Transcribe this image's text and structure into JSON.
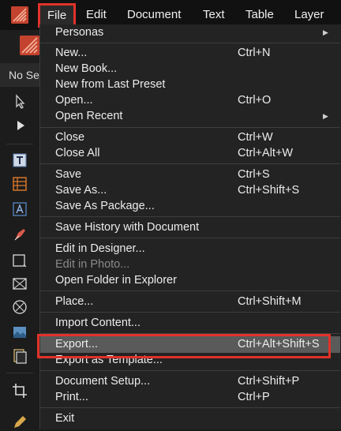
{
  "colors": {
    "accent_red": "#e0322a",
    "menu_bg": "#232323",
    "highlight": "#5a5a5a",
    "logo": "#c4432f"
  },
  "menubar": {
    "items": [
      "File",
      "Edit",
      "Document",
      "Text",
      "Table",
      "Layer"
    ],
    "active": "File"
  },
  "context": {
    "no_selection": "No Se"
  },
  "tools": [
    "pointer-icon",
    "node-icon",
    "text-frame-icon",
    "table-icon",
    "artistic-text-icon",
    "pen-icon",
    "rectangle-icon",
    "picture-frame-icon",
    "ellipse-icon",
    "image-icon",
    "place-icon",
    "crop-icon",
    "pencil-icon"
  ],
  "file_menu": {
    "personas": "Personas",
    "new": {
      "label": "New...",
      "shortcut": "Ctrl+N"
    },
    "new_book": "New Book...",
    "new_from_preset": "New from Last Preset",
    "open": {
      "label": "Open...",
      "shortcut": "Ctrl+O"
    },
    "open_recent": "Open Recent",
    "close": {
      "label": "Close",
      "shortcut": "Ctrl+W"
    },
    "close_all": {
      "label": "Close All",
      "shortcut": "Ctrl+Alt+W"
    },
    "save": {
      "label": "Save",
      "shortcut": "Ctrl+S"
    },
    "save_as": {
      "label": "Save As...",
      "shortcut": "Ctrl+Shift+S"
    },
    "save_as_package": "Save As Package...",
    "save_history": "Save History with Document",
    "edit_in_designer": "Edit in Designer...",
    "edit_in_photo": "Edit in Photo...",
    "open_folder": "Open Folder in Explorer",
    "place": {
      "label": "Place...",
      "shortcut": "Ctrl+Shift+M"
    },
    "import_content": "Import Content...",
    "export": {
      "label": "Export...",
      "shortcut": "Ctrl+Alt+Shift+S"
    },
    "export_template": "Export as Template...",
    "document_setup": {
      "label": "Document Setup...",
      "shortcut": "Ctrl+Shift+P"
    },
    "print": {
      "label": "Print...",
      "shortcut": "Ctrl+P"
    },
    "exit": "Exit"
  }
}
